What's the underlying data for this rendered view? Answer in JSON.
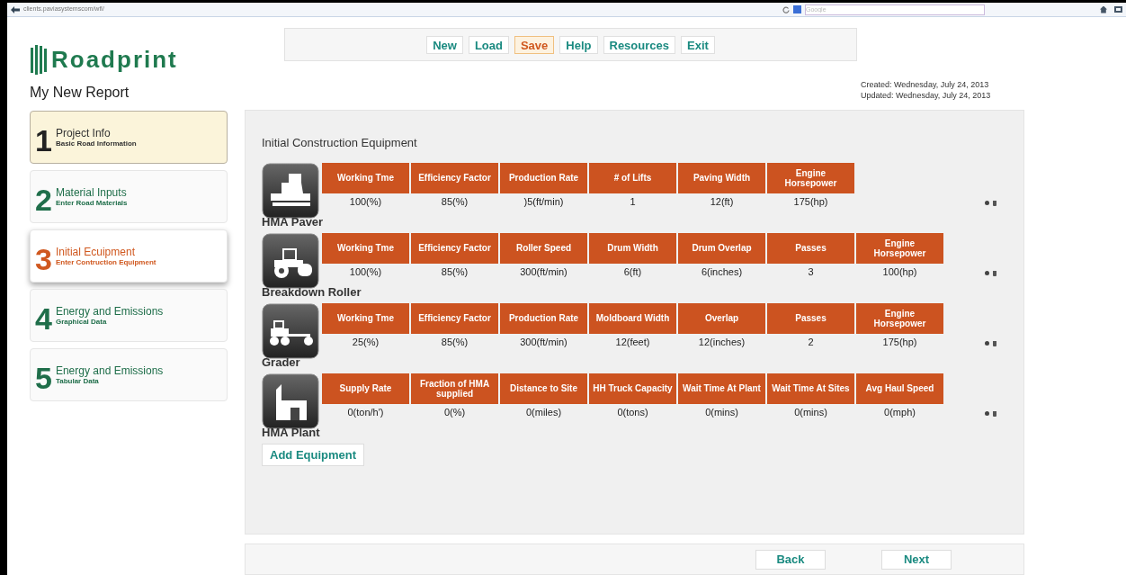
{
  "browser": {
    "url": "clients.paviasystemscom/wfl/",
    "search_placeholder": "Google"
  },
  "app": {
    "title": "Roadprint",
    "report_title": "My New Report"
  },
  "toolbar": [
    {
      "label": "New",
      "selected": false
    },
    {
      "label": "Load",
      "selected": false
    },
    {
      "label": "Save",
      "selected": true
    },
    {
      "label": "Help",
      "selected": false
    },
    {
      "label": "Resources",
      "selected": false
    },
    {
      "label": "Exit",
      "selected": false
    }
  ],
  "dates": {
    "created": "Created: Wednesday, July 24, 2013",
    "updated": "Updated: Wednesday, July 24, 2013"
  },
  "steps": [
    {
      "number": "1",
      "title": "Project Info",
      "subtitle": "Basic Road Information",
      "selected": false,
      "hovered": true
    },
    {
      "number": "2",
      "title": "Material Inputs",
      "subtitle": "Enter Road Materials",
      "selected": false,
      "hovered": false
    },
    {
      "number": "3",
      "title": "Initial Ecuipment",
      "subtitle": "Enter Contruction Equipment",
      "selected": true,
      "hovered": false
    },
    {
      "number": "4",
      "title": "Energy and Emissions",
      "subtitle": "Graphical Data",
      "selected": false,
      "hovered": false
    },
    {
      "number": "5",
      "title": "Energy and Emissions",
      "subtitle": "Tabular Data",
      "selected": false,
      "hovered": false
    }
  ],
  "section_title": "Initial Construction Equipment",
  "equipment": [
    {
      "kind": "paver",
      "name": "HMA Paver",
      "fields": [
        {
          "label": "Working Tme",
          "value": "100(%)"
        },
        {
          "label": "Efficiency Factor",
          "value": "85(%)"
        },
        {
          "label": "Production Rate",
          "value": ")5(ft/min)"
        },
        {
          "label": "# of Lifts",
          "value": "1"
        },
        {
          "label": "Paving Width",
          "value": "12(ft)"
        },
        {
          "label": "Engine Horsepower",
          "value": "175(hp)"
        }
      ]
    },
    {
      "kind": "roller",
      "name": "Breakdown Roller",
      "fields": [
        {
          "label": "Working Tme",
          "value": "100(%)"
        },
        {
          "label": "Efficiency Factor",
          "value": "85(%)"
        },
        {
          "label": "Roller Speed",
          "value": "300(ft/min)"
        },
        {
          "label": "Drum Width",
          "value": "6(ft)"
        },
        {
          "label": "Drum Overlap",
          "value": "6(inches)"
        },
        {
          "label": "Passes",
          "value": "3"
        },
        {
          "label": "Engine Horsepower",
          "value": "100(hp)"
        }
      ]
    },
    {
      "kind": "grader",
      "name": "Grader",
      "fields": [
        {
          "label": "Working Tme",
          "value": "25(%)"
        },
        {
          "label": "Efficiency Factor",
          "value": "85(%)"
        },
        {
          "label": "Production Rate",
          "value": "300(ft/min)"
        },
        {
          "label": "Moldboard Width",
          "value": "12(feet)"
        },
        {
          "label": "Overlap",
          "value": "12(inches)"
        },
        {
          "label": "Passes",
          "value": "2"
        },
        {
          "label": "Engine Horsepower",
          "value": "175(hp)"
        }
      ]
    },
    {
      "kind": "plant",
      "name": "HMA Plant",
      "fields": [
        {
          "label": "Supply Rate",
          "value": "0(ton/h')"
        },
        {
          "label": "Fraction of HMA supplied",
          "value": "0(%)"
        },
        {
          "label": "Distance to Site",
          "value": "0(miles)"
        },
        {
          "label": "HH Truck Capacity",
          "value": "0(tons)"
        },
        {
          "label": "Wait Time At Plant",
          "value": "0(mins)"
        },
        {
          "label": "Wait Time At Sites",
          "value": "0(mins)"
        },
        {
          "label": "Avg Haul Speed",
          "value": "0(mph)"
        }
      ]
    }
  ],
  "add_button": "Add Equipment",
  "footer": {
    "back": "Back",
    "next": "Next"
  }
}
